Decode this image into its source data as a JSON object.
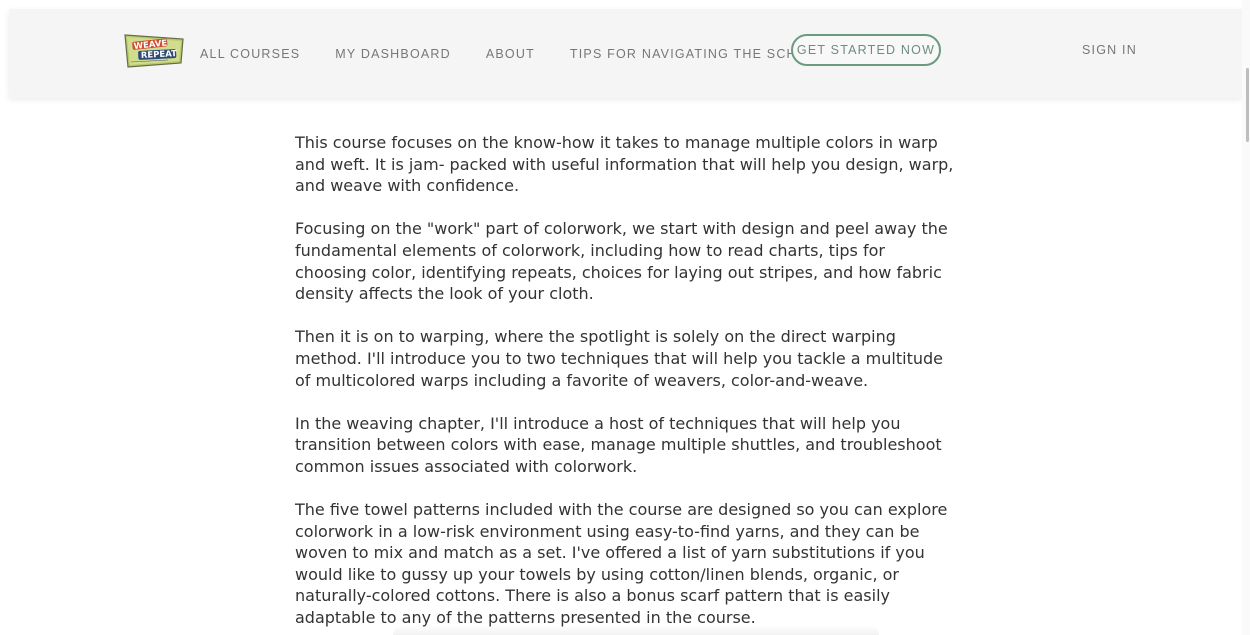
{
  "header": {
    "logo": {
      "line1": "WEAVE",
      "line2": "REPEAT"
    },
    "nav": [
      {
        "label": "ALL COURSES"
      },
      {
        "label": "MY DASHBOARD"
      },
      {
        "label": "ABOUT"
      },
      {
        "label": "TIPS FOR NAVIGATING THE SCHOOL"
      }
    ],
    "cta_label": "GET STARTED NOW",
    "signin_label": "SIGN IN"
  },
  "content": {
    "paragraphs": [
      "This course focuses on the know-how it takes to manage multiple colors in warp and weft. It is jam- packed with useful information that will help you design, warp, and weave with confidence.",
      "Focusing on the \"work\" part of colorwork, we start with design and peel away the fundamental elements of colorwork, including how to read charts, tips for choosing color, identifying repeats, choices for laying out stripes, and how fabric density affects the look of your cloth.",
      "Then it is on to warping, where the spotlight is solely on the direct warping method. I'll introduce you to two techniques that will help you tackle a multitude of multicolored warps including a favorite of weavers, color-and-weave.",
      "In the weaving chapter, I'll introduce a host of techniques that will help you transition between colors with ease, manage multiple shuttles, and troubleshoot common issues associated with colorwork.",
      "The five towel patterns included with the course are designed so you can explore colorwork in a low-risk environment using easy-to-find yarns, and they can be woven to mix and match as a set. I've offered a list of yarn substitutions if you would like to gussy up your towels by using cotton/linen blends, organic, or naturally-colored cottons. There is also a bonus scarf pattern that is easily adaptable to any of the patterns presented in the course."
    ]
  },
  "colors": {
    "accent": "#6a9a82",
    "header_bg": "#f5f5f5",
    "nav_text": "#777777",
    "body_text": "#333333"
  }
}
